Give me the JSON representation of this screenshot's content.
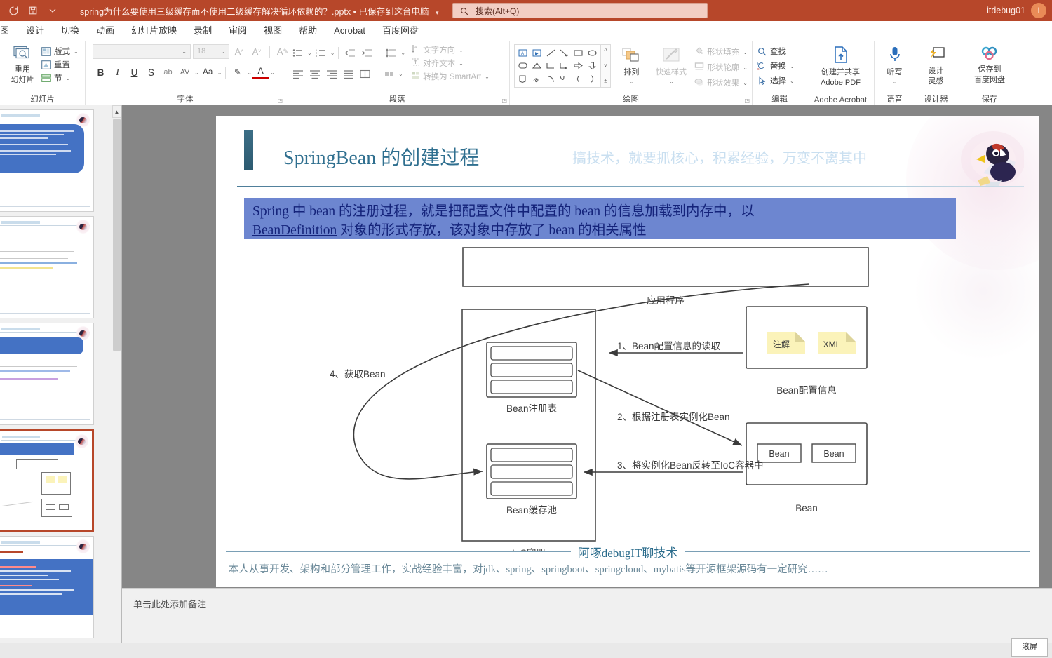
{
  "titlebar": {
    "qat": [
      {
        "name": "autosave-icon",
        "label": "↻"
      },
      {
        "name": "save-icon",
        "label": "⎘"
      },
      {
        "name": "customize-qat-icon",
        "label": "⌄"
      }
    ],
    "document_title": "spring为什么要使用三级缓存而不使用二级缓存解决循环依赖的？.pptx • 已保存到这台电脑",
    "title_caret": "▾",
    "search_placeholder": "搜索(Alt+Q)",
    "user_name": "itdebug01",
    "avatar_initial": "I",
    "bg_color": "#b7472a"
  },
  "tabs": [
    {
      "label": "图",
      "name": "tab-insert-partial"
    },
    {
      "label": "设计",
      "name": "tab-design"
    },
    {
      "label": "切换",
      "name": "tab-transitions"
    },
    {
      "label": "动画",
      "name": "tab-animations"
    },
    {
      "label": "幻灯片放映",
      "name": "tab-slideshow"
    },
    {
      "label": "录制",
      "name": "tab-record"
    },
    {
      "label": "审阅",
      "name": "tab-review"
    },
    {
      "label": "视图",
      "name": "tab-view"
    },
    {
      "label": "帮助",
      "name": "tab-help"
    },
    {
      "label": "Acrobat",
      "name": "tab-acrobat"
    },
    {
      "label": "百度网盘",
      "name": "tab-baidunetdisk"
    }
  ],
  "ribbon": {
    "slides": {
      "group_label": "幻灯片",
      "reuse_label": "重用\n幻灯片",
      "reuse_line1": "重用",
      "reuse_line2": "幻灯片",
      "layout": "版式",
      "reset": "重置",
      "section": "节"
    },
    "font": {
      "group_label": "字体",
      "font_name_value": "",
      "font_size_value": "18",
      "grow_font": "A",
      "shrink_font": "A",
      "clear_format": "A",
      "bold": "B",
      "italic": "I",
      "underline": "U",
      "shadow": "S",
      "strikethrough": "ab",
      "char_spacing": "AV",
      "change_case": "Aa",
      "text_highlight": "✎",
      "font_color": "A"
    },
    "paragraph": {
      "group_label": "段落",
      "text_direction": "文字方向",
      "align_text": "对齐文本",
      "convert_smartart": "转换为 SmartArt"
    },
    "drawing": {
      "group_label": "绘图",
      "arrange": "排列",
      "quick_styles": "快速样式",
      "shape_fill": "形状填充",
      "shape_outline": "形状轮廓",
      "shape_effects": "形状效果"
    },
    "editing": {
      "group_label": "编辑",
      "find": "查找",
      "replace": "替换",
      "select": "选择"
    },
    "acrobat": {
      "group_label": "Adobe Acrobat",
      "create_share_line1": "创建并共享",
      "create_share_line2": "Adobe PDF"
    },
    "voice": {
      "group_label": "语音",
      "dictate": "听写"
    },
    "designer": {
      "group_label": "设计器",
      "design_line1": "设计",
      "design_line2": "灵感"
    },
    "save": {
      "group_label": "保存",
      "save_line1": "保存到",
      "save_line2": "百度网盘"
    }
  },
  "slide": {
    "title_en": "SpringBean",
    "title_cn": " 的创建过程",
    "subtitle": "搞技术，就要抓核心，积累经验，万变不离其中",
    "banner_line1": "Spring 中 bean 的注册过程，就是把配置文件中配置的 bean 的信息加载到内存中，以",
    "banner_line2_u": "BeanDefinition",
    "banner_line2": " 对象的形式存放，该对象中存放了 bean 的相关属性",
    "footer_brand": "阿啄debugIT聊技术",
    "footer_desc": "本人从事开发、架构和部分管理工作，实战经验丰富，对jdk、spring、springboot、springcloud、mybatis等开源框架源码有一定研究……",
    "title_color": "#2f6f8f",
    "banner_bg": "#6d86d0",
    "banner_text_color": "#14237a"
  },
  "diagram": {
    "app_label": "应用程序",
    "ioc_label": "IoC容器",
    "bean_registry_label": "Bean注册表",
    "bean_cache_label": "Bean缓存池",
    "bean_config_label": "Bean配置信息",
    "bean_box_label": "Bean",
    "annotation_tag": "注解",
    "xml_tag": "XML",
    "bean_chip_1": "Bean",
    "bean_chip_2": "Bean",
    "step1": "1、Bean配置信息的读取",
    "step2": "2、根据注册表实例化Bean",
    "step3": "3、将实例化Bean反转至IoC容器中",
    "step4": "4、获取Bean",
    "note_fill": "#fbf3ba",
    "stroke": "#4a4a4a"
  },
  "notes": {
    "placeholder": "单击此处添加备注"
  },
  "status": {
    "zoom_chip": "滚屏"
  }
}
